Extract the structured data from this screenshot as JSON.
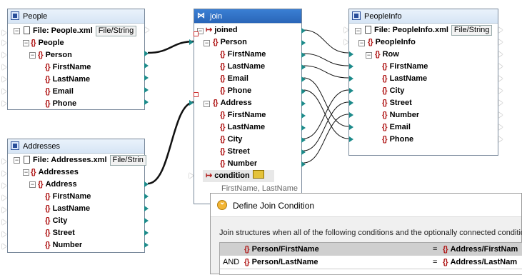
{
  "people": {
    "title": "People",
    "file_label": "File: People.xml",
    "file_btn": "File/String",
    "items": [
      "People",
      "Person",
      "FirstName",
      "LastName",
      "Email",
      "Phone"
    ]
  },
  "addresses": {
    "title": "Addresses",
    "file_label": "File: Addresses.xml",
    "file_btn": "File/Strin",
    "items": [
      "Addresses",
      "Address",
      "FirstName",
      "LastName",
      "City",
      "Street",
      "Number"
    ]
  },
  "join": {
    "title": "join",
    "items": [
      "joined",
      "Person",
      "FirstName",
      "LastName",
      "Email",
      "Phone",
      "Address",
      "FirstName",
      "LastName",
      "City",
      "Street",
      "Number"
    ],
    "condition_label": "condition",
    "condition_hint": "FirstName, LastName"
  },
  "peopleinfo": {
    "title": "PeopleInfo",
    "file_label": "File: PeopleInfo.xml",
    "file_btn": "File/String",
    "items": [
      "PeopleInfo",
      "Row",
      "FirstName",
      "LastName",
      "City",
      "Street",
      "Number",
      "Email",
      "Phone"
    ]
  },
  "dialog": {
    "title": "Define Join Condition",
    "description": "Join structures when all of the following conditions and the optionally connected conditio",
    "rows": [
      {
        "op": "",
        "left": "Person/FirstName",
        "eq": "=",
        "right": "Address/FirstNam"
      },
      {
        "op": "AND",
        "left": "Person/LastName",
        "eq": "=",
        "right": "Address/LastNam"
      }
    ]
  },
  "icons": {
    "element": "{}",
    "join": "⋈"
  },
  "colors": {
    "connector": "#111111",
    "pin": "#1c8a8a",
    "element_icon": "#b01818",
    "join_title": "#2a66b8"
  }
}
